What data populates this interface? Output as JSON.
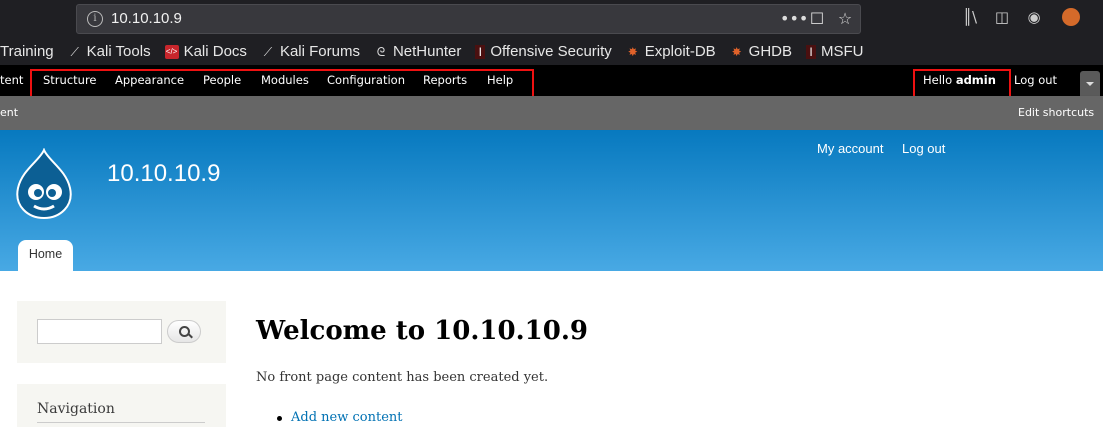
{
  "browser": {
    "url": "10.10.10.9",
    "url_actions": [
      "•••",
      "☐",
      "☆"
    ],
    "toolbar_icons": [
      "library-icon",
      "sidebar-icon",
      "account-icon",
      "extension-icon"
    ],
    "bookmarks": [
      {
        "label": "Training",
        "icon": ""
      },
      {
        "label": "Kali Tools",
        "icon": "kali-dragon-icon"
      },
      {
        "label": "Kali Docs",
        "icon": "kali-docs-icon"
      },
      {
        "label": "Kali Forums",
        "icon": "kali-dragon-icon"
      },
      {
        "label": "NetHunter",
        "icon": "nethunter-icon"
      },
      {
        "label": "Offensive Security",
        "icon": "offsec-icon"
      },
      {
        "label": "Exploit-DB",
        "icon": "exploit-db-icon"
      },
      {
        "label": "GHDB",
        "icon": "ghdb-icon"
      },
      {
        "label": "MSFU",
        "icon": "msfu-icon"
      }
    ]
  },
  "admin_toolbar": {
    "partial_left": "tent",
    "items": [
      "Structure",
      "Appearance",
      "People",
      "Modules",
      "Configuration",
      "Reports",
      "Help"
    ],
    "hello_prefix": "Hello ",
    "username": "admin",
    "logout": "Log out"
  },
  "shortcut_bar": {
    "partial_left": "ent",
    "edit_shortcuts": "Edit shortcuts"
  },
  "header": {
    "site_name": "10.10.10.9",
    "my_account": "My account",
    "log_out": "Log out",
    "tab_home": "Home"
  },
  "sidebar": {
    "navigation_title": "Navigation"
  },
  "main": {
    "title": "Welcome to 10.10.10.9",
    "message": "No front page content has been created yet.",
    "add_link": "Add new content"
  },
  "colors": {
    "header_top": "#0779bf",
    "header_bottom": "#48a9e4",
    "highlight_box": "#ee1111",
    "link": "#0071b3"
  }
}
